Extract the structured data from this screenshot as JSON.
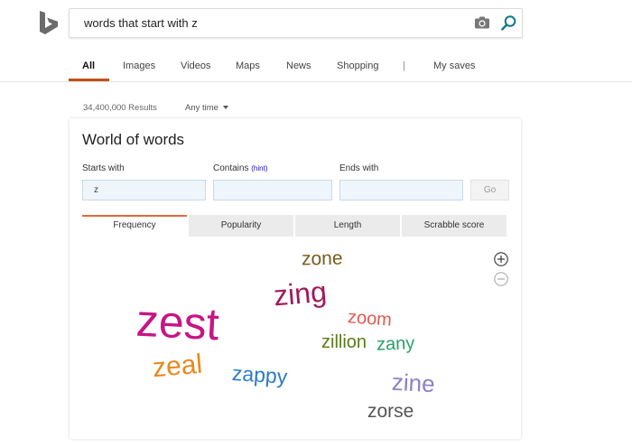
{
  "search": {
    "query": "words that start with z"
  },
  "nav": {
    "items": [
      "All",
      "Images",
      "Videos",
      "Maps",
      "News",
      "Shopping",
      "|",
      "My saves"
    ],
    "active": "All"
  },
  "results": {
    "count": "34,400,000 Results",
    "time_filter": "Any time"
  },
  "card": {
    "title": "World of words",
    "starts_with_label": "Starts with",
    "contains_label": "Contains",
    "hint": "(hint)",
    "ends_with_label": "Ends with",
    "starts_with_value": "z",
    "contains_value": "",
    "ends_with_value": "",
    "go_label": "Go",
    "tabs": [
      "Frequency",
      "Popularity",
      "Length",
      "Scrabble score"
    ],
    "active_tab": "Frequency",
    "zoom_in": "+",
    "zoom_out": "−"
  },
  "word_cloud": [
    {
      "word": "zone",
      "color": "#7a5a1c"
    },
    {
      "word": "zing",
      "color": "#a3195b"
    },
    {
      "word": "zest",
      "color": "#c71585"
    },
    {
      "word": "zoom",
      "color": "#e05a4e"
    },
    {
      "word": "zillion",
      "color": "#5a7a1a"
    },
    {
      "word": "zany",
      "color": "#24a36b"
    },
    {
      "word": "zeal",
      "color": "#e8891d"
    },
    {
      "word": "zappy",
      "color": "#2b7cc9"
    },
    {
      "word": "zine",
      "color": "#8e7fc8"
    },
    {
      "word": "zorse",
      "color": "#555555"
    }
  ],
  "colors": {
    "accent_underline": "#c44e16",
    "active_tab_border": "#e06a3e",
    "search_icon": "#0e7a8c",
    "logo": "#6b6b6b",
    "field_bg": "#eef5fb"
  },
  "icons": {
    "logo": "bing-logo-icon",
    "camera": "camera-icon",
    "search": "search-icon",
    "caret": "chevron-down-icon",
    "zoom_in": "zoom-in-icon",
    "zoom_out": "zoom-out-icon"
  }
}
